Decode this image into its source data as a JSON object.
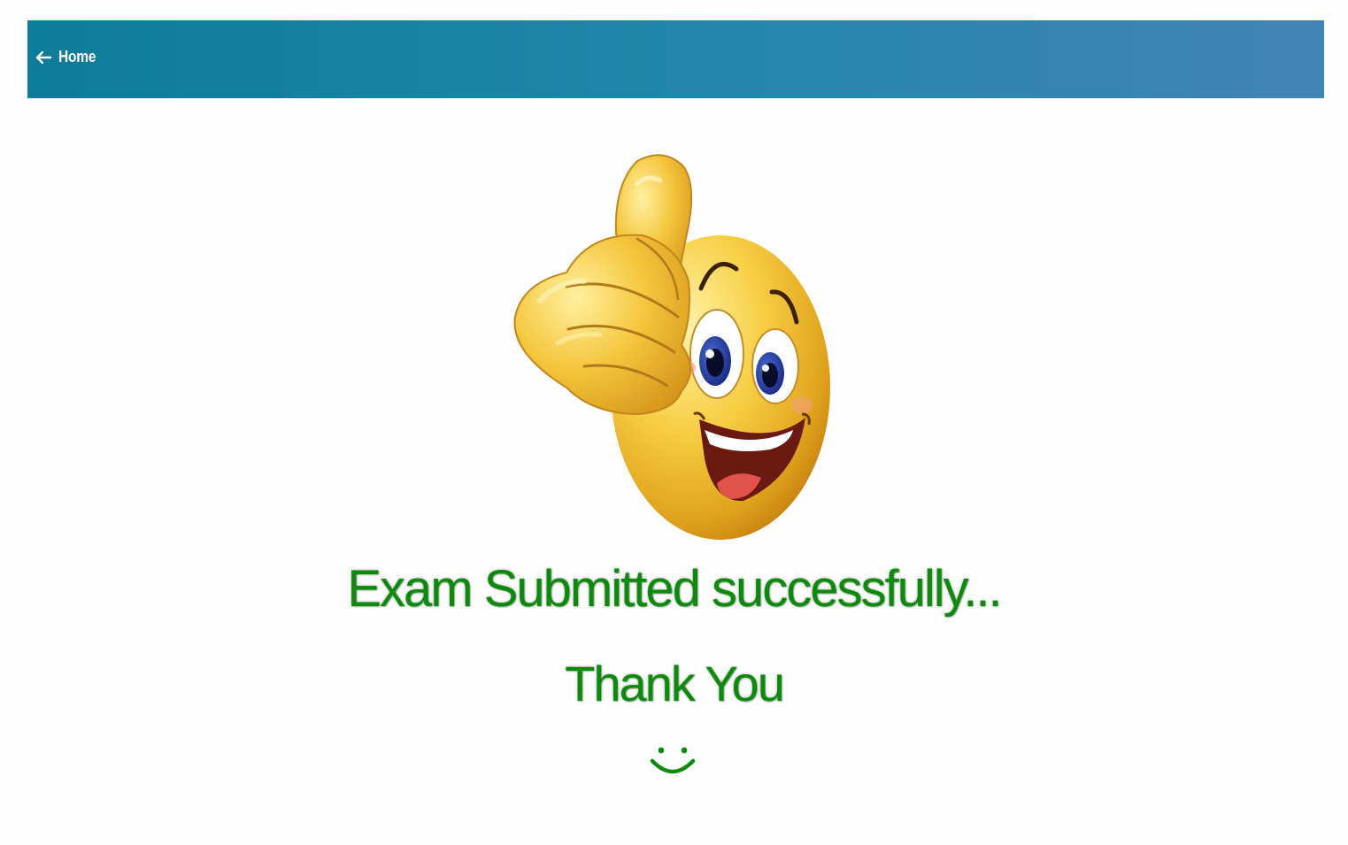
{
  "header": {
    "back_label": "Home",
    "background_gradient": [
      "#0d7c9a",
      "#4184b6"
    ]
  },
  "main": {
    "illustration_icon": "thumbs-up-smiley-icon",
    "message_line1": "Exam Submitted successfully...",
    "message_line2": "Thank You",
    "message_color": "#0b8a0b",
    "smile_icon": "smiley-icon"
  }
}
